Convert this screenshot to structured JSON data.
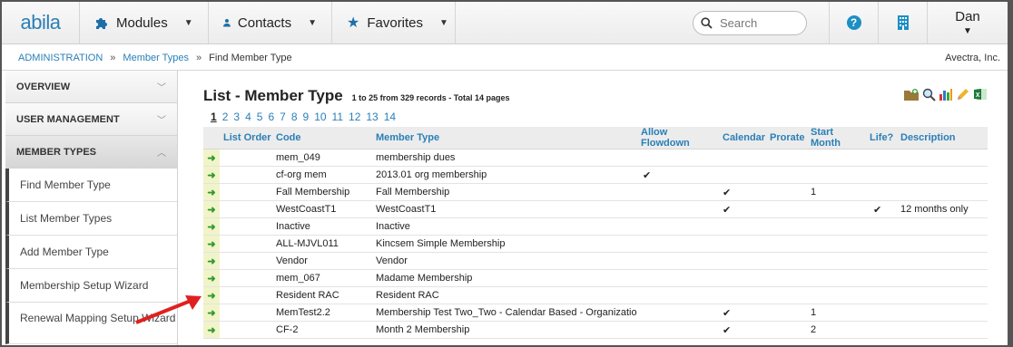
{
  "app": {
    "logo": "abila"
  },
  "nav": {
    "modules": "Modules",
    "contacts": "Contacts",
    "favorites": "Favorites",
    "search_placeholder": "Search",
    "user": "Dan"
  },
  "breadcrumb": {
    "items": [
      "ADMINISTRATION",
      "Member Types",
      "Find Member Type"
    ],
    "separator": "»",
    "company": "Avectra, Inc."
  },
  "sidebar": {
    "sections": [
      "OVERVIEW",
      "USER MANAGEMENT",
      "MEMBER TYPES"
    ],
    "items": [
      "Find Member Type",
      "List Member Types",
      "Add Member Type",
      "Membership Setup Wizard",
      "Renewal Mapping Setup Wizard"
    ]
  },
  "main": {
    "title": "List - Member Type",
    "meta": "1 to 25 from 329 records - Total 14 pages",
    "pages": [
      "1",
      "2",
      "3",
      "4",
      "5",
      "6",
      "7",
      "8",
      "9",
      "10",
      "11",
      "12",
      "13",
      "14"
    ],
    "current_page": "1",
    "columns": [
      "List Order",
      "Code",
      "Member Type",
      "Allow Flowdown",
      "Calendar",
      "Prorate",
      "Start Month",
      "Life?",
      "Description"
    ],
    "rows": [
      {
        "code": "mem_049",
        "type": "membership dues",
        "flowdown": "",
        "calendar": "",
        "prorate": "",
        "start": "",
        "life": "",
        "desc": ""
      },
      {
        "code": "cf-org mem",
        "type": "2013.01 org membership",
        "flowdown": "✔",
        "calendar": "",
        "prorate": "",
        "start": "",
        "life": "",
        "desc": ""
      },
      {
        "code": "Fall Membership",
        "type": "Fall Membership",
        "flowdown": "",
        "calendar": "✔",
        "prorate": "",
        "start": "1",
        "life": "",
        "desc": ""
      },
      {
        "code": "WestCoastT1",
        "type": "WestCoastT1",
        "flowdown": "",
        "calendar": "✔",
        "prorate": "",
        "start": "",
        "life": "✔",
        "desc": "12 months only"
      },
      {
        "code": "Inactive",
        "type": "Inactive",
        "flowdown": "",
        "calendar": "",
        "prorate": "",
        "start": "",
        "life": "",
        "desc": ""
      },
      {
        "code": "ALL-MJVL011",
        "type": "Kincsem Simple Membership",
        "flowdown": "",
        "calendar": "",
        "prorate": "",
        "start": "",
        "life": "",
        "desc": ""
      },
      {
        "code": "Vendor",
        "type": "Vendor",
        "flowdown": "",
        "calendar": "",
        "prorate": "",
        "start": "",
        "life": "",
        "desc": ""
      },
      {
        "code": "mem_067",
        "type": "Madame Membership",
        "flowdown": "",
        "calendar": "",
        "prorate": "",
        "start": "",
        "life": "",
        "desc": ""
      },
      {
        "code": "Resident RAC",
        "type": "Resident RAC",
        "flowdown": "",
        "calendar": "",
        "prorate": "",
        "start": "",
        "life": "",
        "desc": ""
      },
      {
        "code": "MemTest2.2",
        "type": "Membership Test Two_Two - Calendar Based - Organization",
        "flowdown": "",
        "calendar": "✔",
        "prorate": "",
        "start": "1",
        "life": "",
        "desc": ""
      },
      {
        "code": "CF-2",
        "type": "Month 2 Membership",
        "flowdown": "",
        "calendar": "✔",
        "prorate": "",
        "start": "2",
        "life": "",
        "desc": ""
      }
    ]
  },
  "colors": {
    "accent": "#2a7fb7",
    "arrow_green": "#2f9a2f",
    "row_highlight": "#f1f4c8",
    "callout_red": "#e02020"
  }
}
